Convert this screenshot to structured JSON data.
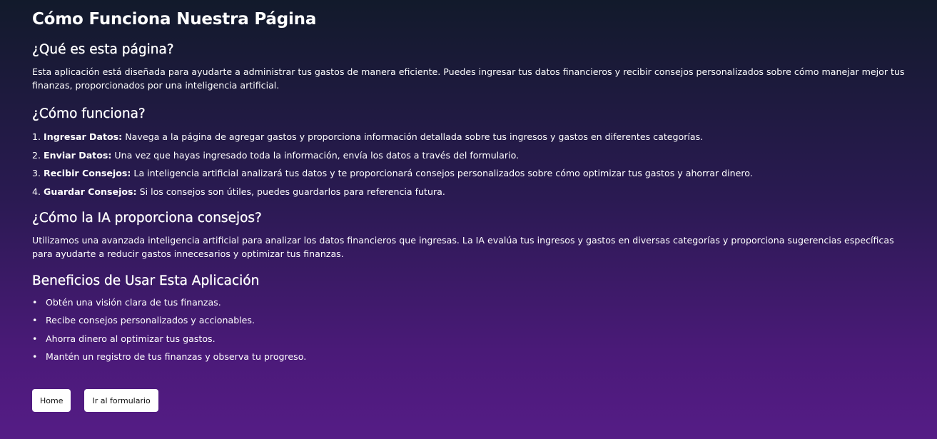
{
  "page": {
    "title": "Cómo Funciona Nuestra Página"
  },
  "section_what": {
    "heading": "¿Qué es esta página?",
    "text": "Esta aplicación está diseñada para ayudarte a administrar tus gastos de manera eficiente. Puedes ingresar tus datos financieros y recibir consejos personalizados sobre cómo manejar mejor tus finanzas, proporcionados por una inteligencia artificial."
  },
  "section_how": {
    "heading": "¿Cómo funciona?",
    "steps": [
      {
        "number": "1.",
        "label": "Ingresar Datos:",
        "text": "Navega a la página de agregar gastos y proporciona información detallada sobre tus ingresos y gastos en diferentes categorías."
      },
      {
        "number": "2.",
        "label": "Enviar Datos:",
        "text": "Una vez que hayas ingresado toda la información, envía los datos a través del formulario."
      },
      {
        "number": "3.",
        "label": "Recibir Consejos:",
        "text": "La inteligencia artificial analizará tus datos y te proporcionará consejos personalizados sobre cómo optimizar tus gastos y ahorrar dinero."
      },
      {
        "number": "4.",
        "label": "Guardar Consejos:",
        "text": "Si los consejos son útiles, puedes guardarlos para referencia futura."
      }
    ]
  },
  "section_ai": {
    "heading": "¿Cómo la IA proporciona consejos?",
    "text": "Utilizamos una avanzada inteligencia artificial para analizar los datos financieros que ingresas. La IA evalúa tus ingresos y gastos en diversas categorías y proporciona sugerencias específicas para ayudarte a reducir gastos innecesarios y optimizar tus finanzas."
  },
  "section_benefits": {
    "heading": "Beneficios de Usar Esta Aplicación",
    "bullet": "•",
    "items": [
      "Obtén una visión clara de tus finanzas.",
      "Recibe consejos personalizados y accionables.",
      "Ahorra dinero al optimizar tus gastos.",
      "Mantén un registro de tus finanzas y observa tu progreso."
    ]
  },
  "buttons": {
    "home_label": "Home",
    "form_label": "Ir al formulario"
  }
}
